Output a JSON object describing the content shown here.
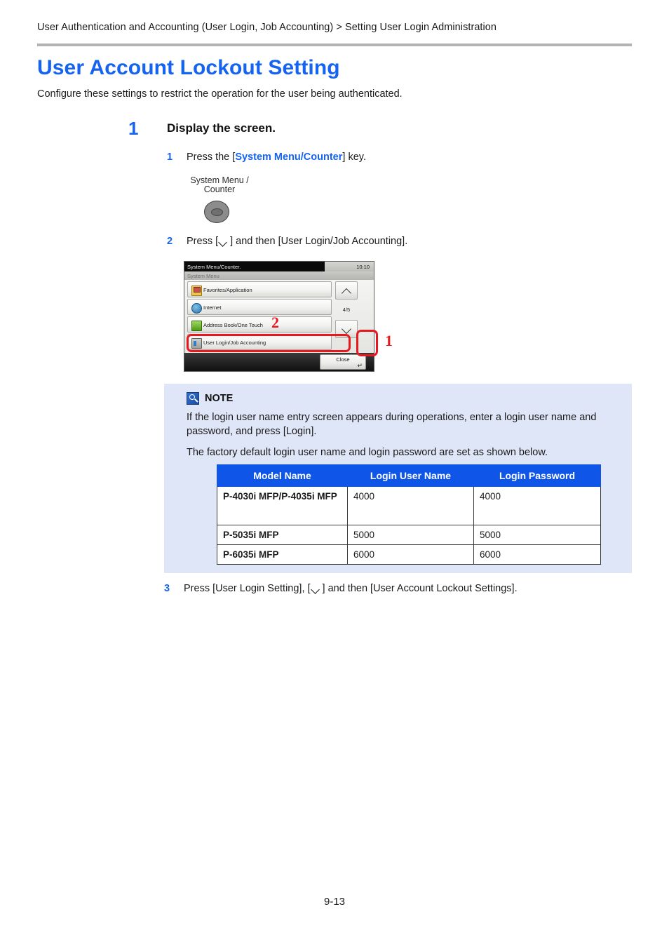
{
  "header": {
    "breadcrumb": "User Authentication and Accounting (User Login, Job Accounting) > Setting User Login Administration"
  },
  "title": "User Account Lockout Setting",
  "intro": "Configure these settings to restrict the operation for the user being authenticated.",
  "step1": {
    "number": "1",
    "heading": "Display the screen.",
    "sub1": {
      "number": "1",
      "before": "Press the [",
      "key": "System Menu/Counter",
      "after": "] key."
    },
    "sub2": {
      "number": "2",
      "before": "Press [",
      "after": "] and then [User Login/Job Accounting]."
    },
    "sub3": {
      "number": "3",
      "before": "Press [User Login Setting], [",
      "after": "] and then [User Account Lockout Settings]."
    }
  },
  "hardware_key": {
    "label_line1": "System Menu /",
    "label_line2": "Counter"
  },
  "panel": {
    "titlebar_text": "System Menu/Counter.",
    "time": "10:10",
    "subbar_text": "System Menu",
    "menu_items": [
      {
        "label": "Favorites/Application",
        "icon": "favorites-icon"
      },
      {
        "label": "Internet",
        "icon": "internet-icon"
      },
      {
        "label": "Address Book/One Touch",
        "icon": "address-book-icon"
      },
      {
        "label": "User Login/Job Accounting",
        "icon": "user-login-icon"
      }
    ],
    "page_indicator": "4/5",
    "close_label": "Close",
    "callout_1": "1",
    "callout_2": "2"
  },
  "note": {
    "title": "NOTE",
    "paragraph1": "If the login user name entry screen appears during operations, enter a login user name and password, and press [Login].",
    "paragraph2": "The factory default login user name and login password are set as shown below.",
    "table": {
      "headers": [
        "Model Name",
        "Login User Name",
        "Login Password"
      ],
      "rows": [
        [
          "P-4030i MFP/P-4035i MFP",
          "4000",
          "4000"
        ],
        [
          "P-5035i MFP",
          "5000",
          "5000"
        ],
        [
          "P-6035i MFP",
          "6000",
          "6000"
        ]
      ]
    }
  },
  "footer": {
    "page_number": "9-13"
  },
  "colors": {
    "accent_blue": "#1663ef",
    "table_header_blue": "#0f56e8",
    "note_bg": "#dfe6f7",
    "callout_red": "#e8181f"
  }
}
